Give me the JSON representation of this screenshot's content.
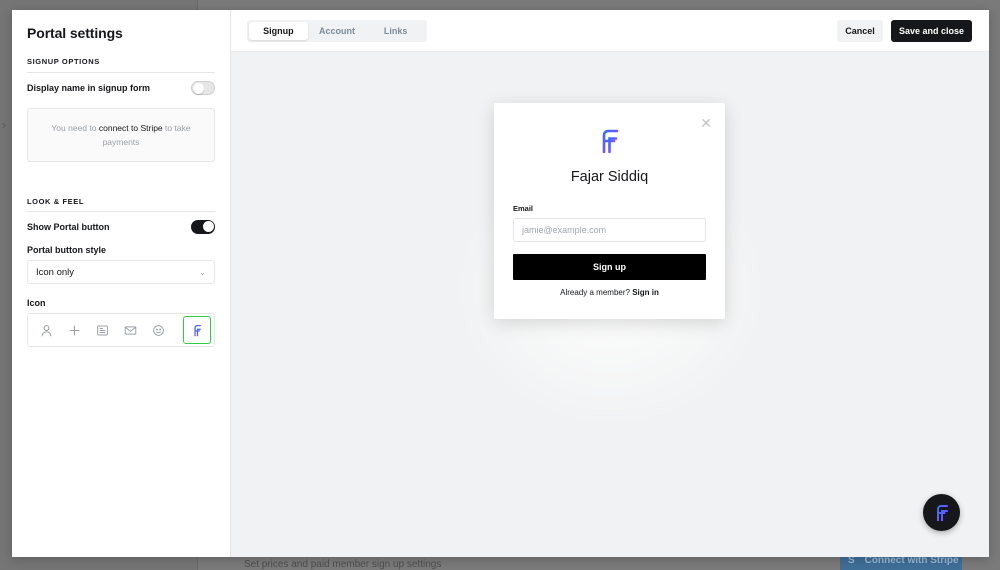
{
  "settings": {
    "title": "Portal settings",
    "signup_options_label": "SIGNUP OPTIONS",
    "display_name_label": "Display name in signup form",
    "display_name_enabled": false,
    "notice_prefix": "You need to",
    "notice_link": "connect to Stripe",
    "notice_suffix": "to take payments",
    "look_feel_label": "LOOK & FEEL",
    "show_portal_label": "Show Portal button",
    "show_portal_enabled": true,
    "button_style_label": "Portal button style",
    "button_style_value": "Icon only",
    "icon_label": "Icon",
    "icons": [
      "user-icon",
      "plus-icon",
      "newsletter-icon",
      "mail-icon",
      "smile-icon",
      "brand-logo-icon"
    ],
    "selected_icon": "brand-logo-icon"
  },
  "preview": {
    "tabs": [
      "Signup",
      "Account",
      "Links"
    ],
    "active_tab": "Signup",
    "cancel_label": "Cancel",
    "save_label": "Save and close",
    "popup": {
      "site_name": "Fajar Siddiq",
      "email_label": "Email",
      "email_placeholder": "jamie@example.com",
      "signup_label": "Sign up",
      "already_text": "Already a member?",
      "signin_label": "Sign in"
    }
  },
  "background": {
    "footer_text": "Set prices and paid member sign up settings",
    "stripe_button": "Connect with Stripe",
    "stripe_mark": "S"
  },
  "colors": {
    "accent_dark": "#15171a",
    "selected_border": "#30cf43",
    "brand_gradient_start": "#2f6fff",
    "brand_gradient_end": "#b63cff"
  }
}
